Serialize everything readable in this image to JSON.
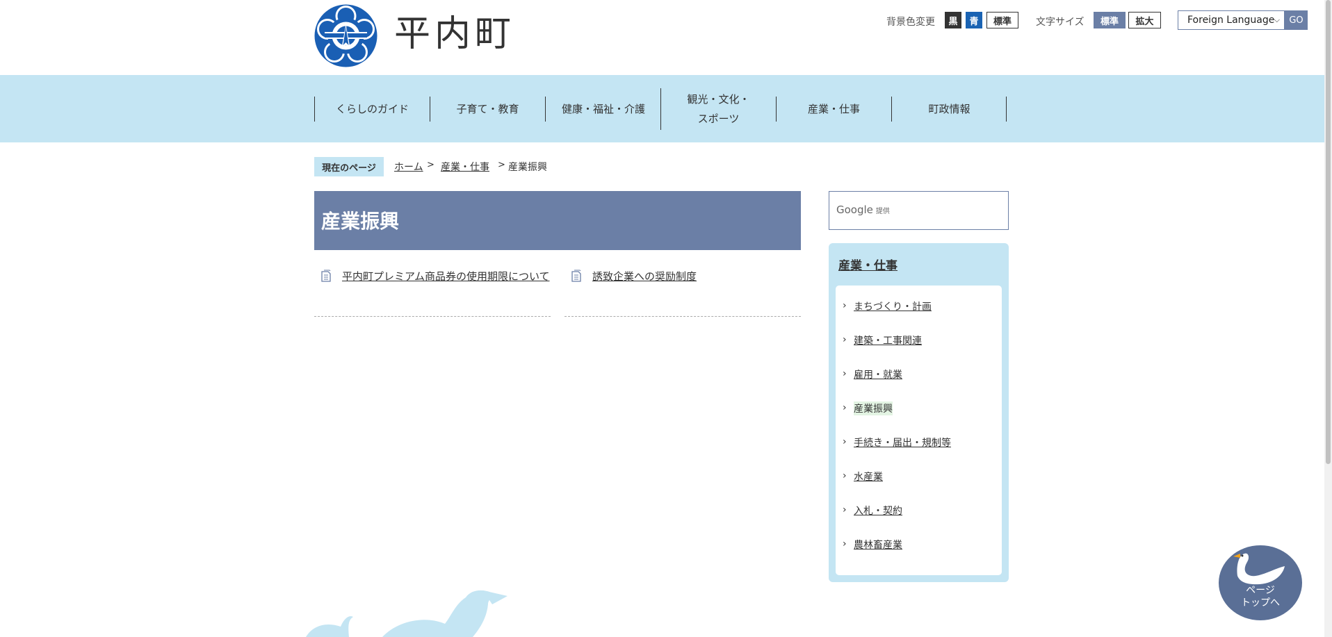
{
  "header": {
    "site_name": "平内町",
    "bg_color_label": "背景色変更",
    "bg_black": "黒",
    "bg_blue": "青",
    "bg_standard": "標準",
    "font_size_label": "文字サイズ",
    "font_standard": "標準",
    "font_large": "拡大",
    "language_select": "Foreign Language",
    "go_button": "GO"
  },
  "nav": {
    "items": [
      "くらしのガイド",
      "子育て・教育",
      "健康・福祉・介護",
      "観光・文化・\nスポーツ",
      "産業・仕事",
      "町政情報"
    ]
  },
  "breadcrumb": {
    "current_label": "現在のページ",
    "home": "ホーム",
    "parent": "産業・仕事",
    "current": "産業振興"
  },
  "main": {
    "title": "産業振興",
    "links": [
      "平内町プレミアム商品券の使用期限について",
      "誘致企業への奨励制度"
    ]
  },
  "sidebar": {
    "search_brand": "Google",
    "search_provided": "提供",
    "title": "産業・仕事",
    "items": [
      "まちづくり・計画",
      "建築・工事関連",
      "雇用・就業",
      "産業振興",
      "手続き・届出・規制等",
      "水産業",
      "入札・契約",
      "農林畜産業"
    ]
  },
  "pagetop": {
    "label_line1": "ページ",
    "label_line2": "トップへ"
  },
  "colors": {
    "accent": "#6b7fa6",
    "nav_bg": "#c4e5f3",
    "logo_blue": "#1a5fb4"
  }
}
